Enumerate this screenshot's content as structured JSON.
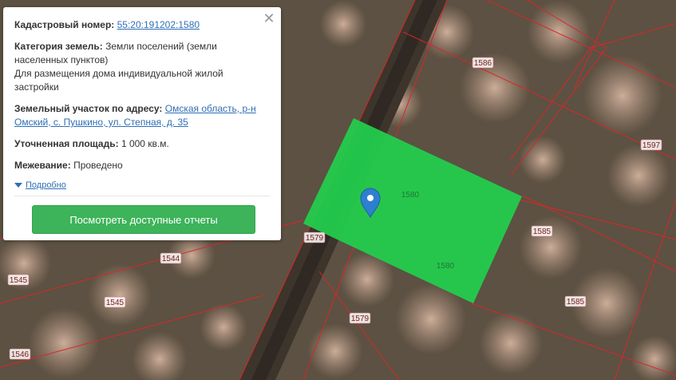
{
  "info_card": {
    "cadastral_label": "Кадастровый номер:",
    "cadastral_value": "55:20:191202:1580",
    "category_label": "Категория земель:",
    "category_value_line1": "Земли поселений (земли",
    "category_value_line2": "населенных пунктов)",
    "category_use_line1": "Для размещения дома индивидуальной жилой",
    "category_use_line2": "застройки",
    "address_label": "Земельный участок по адресу:",
    "address_value_line1": "Омская область, р-н",
    "address_value_line2": "Омский, с. Пушкино, ул. Степная, д. 35",
    "area_label": "Уточненная площадь:",
    "area_value": "1 000 кв.м.",
    "survey_label": "Межевание:",
    "survey_value": "Проведено",
    "details_label": "Подробно",
    "reports_button": "Посмотреть доступные отчеты",
    "close_glyph": "✕"
  },
  "map": {
    "parcel_labels": [
      "1586",
      "1597",
      "1580",
      "1580",
      "1585",
      "1585",
      "1579",
      "1579",
      "1544",
      "1545",
      "1545",
      "1546"
    ],
    "highlight_color": "#22d04e",
    "boundary_color": "#d9262a",
    "marker_icon": "map-pin-icon"
  }
}
